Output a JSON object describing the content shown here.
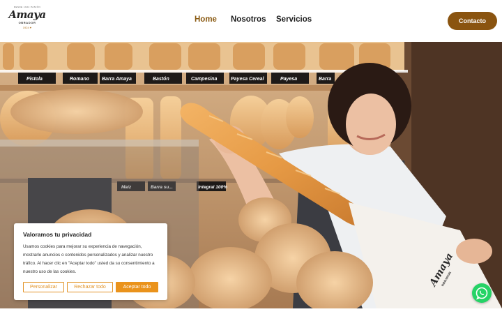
{
  "logo": {
    "tagline": "DESDE 1924 PASIÓN",
    "name": "Amaya",
    "sub": "OBRADOR",
    "year": "1924 ♥"
  },
  "nav": {
    "items": [
      {
        "label": "Home",
        "active": true
      },
      {
        "label": "Nosotros",
        "active": false
      },
      {
        "label": "Servicios",
        "active": false
      }
    ],
    "contact_label": "Contacto"
  },
  "hero": {
    "shelf_labels": [
      "Pistola",
      "Romano",
      "Barra Amaya",
      "Bastón",
      "Campesina",
      "Payesa Cereal",
      "Payesa",
      "Barra",
      "Maíz",
      "Barra su...",
      "Integral 100%"
    ],
    "bag_brand": "Amaya",
    "bag_sub": "OBRADOR"
  },
  "cookie": {
    "title": "Valoramos tu privacidad",
    "text": "Usamos cookies para mejorar su experiencia de navegación, mostrarle anuncios o contenidos personalizados y analizar nuestro tráfico. Al hacer clic en \"Aceptar todo\" usted da su consentimiento a nuestro uso de las cookies.",
    "customize_label": "Personalizar",
    "reject_label": "Rechazar todo",
    "accept_label": "Aceptar todo"
  },
  "colors": {
    "brand": "#8a5410",
    "accent": "#ea931c",
    "whatsapp": "#25d366"
  }
}
